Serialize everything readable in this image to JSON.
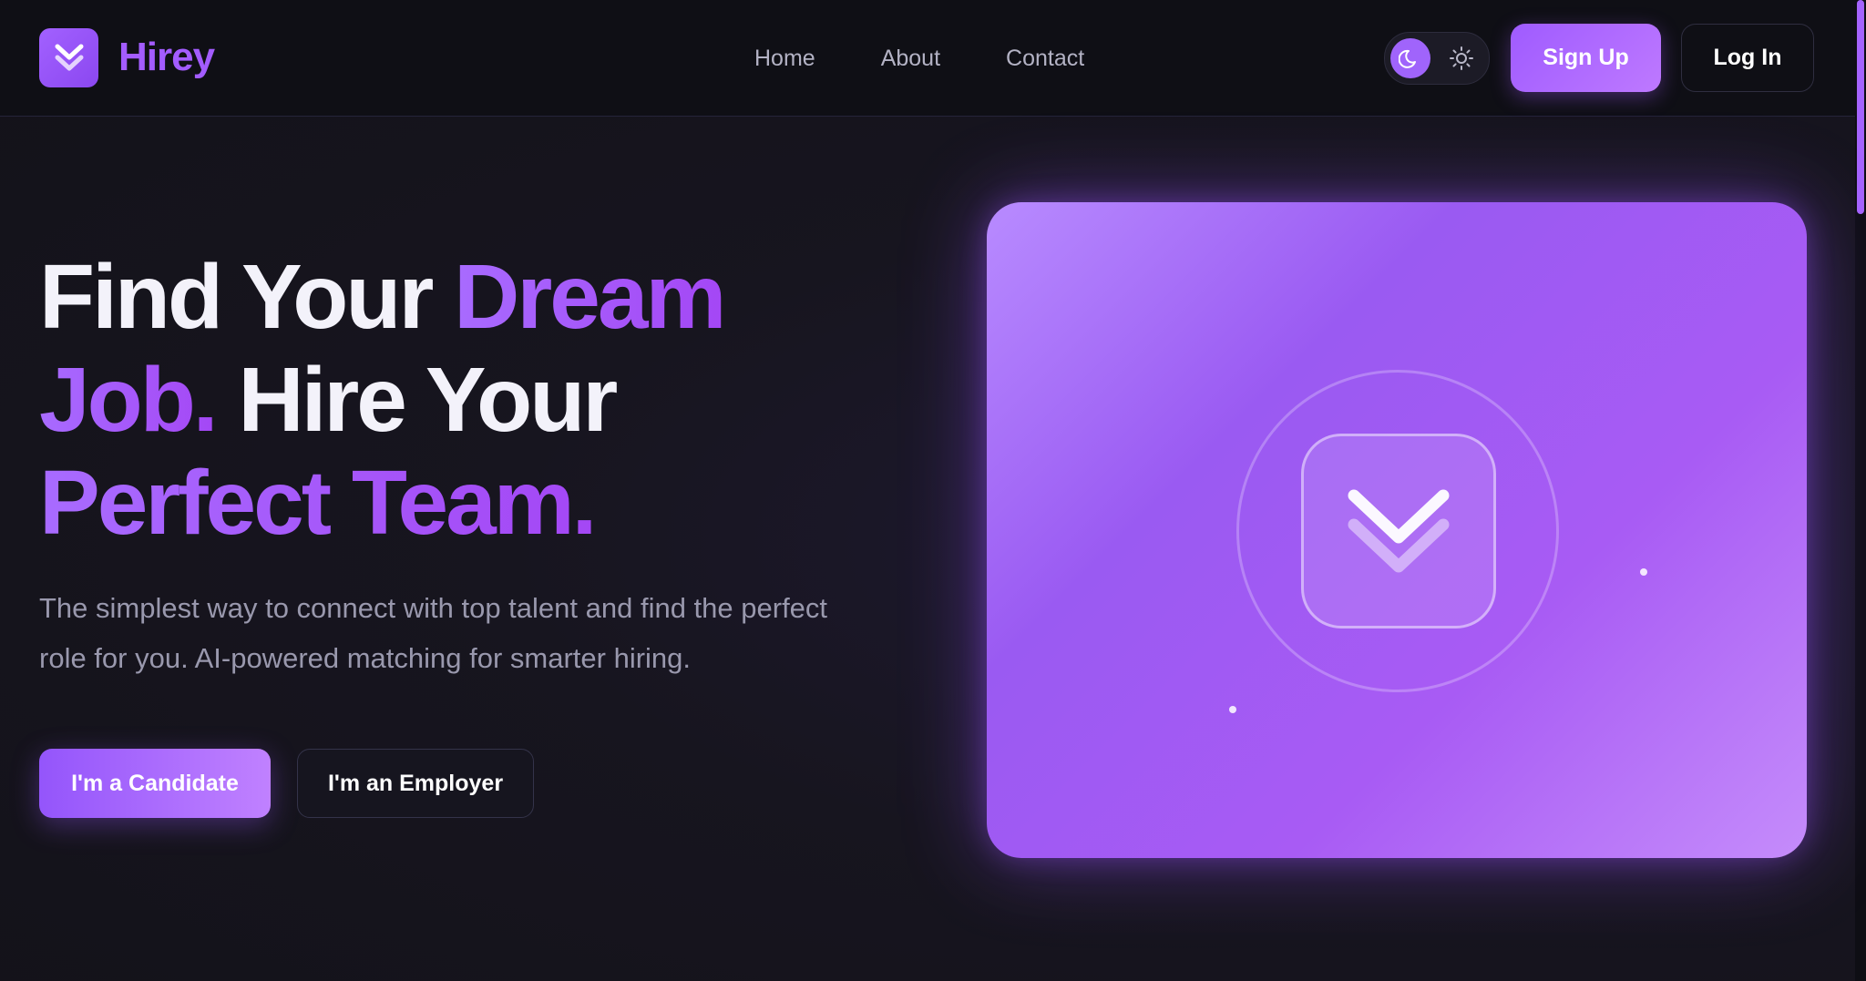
{
  "brand": {
    "name": "Hirey",
    "logo_icon": "double-chevron-down-icon",
    "accent_color": "#a35cff"
  },
  "nav": {
    "links": [
      "Home",
      "About",
      "Contact"
    ]
  },
  "theme_toggle": {
    "active": "dark",
    "dark_icon": "moon-icon",
    "light_icon": "sun-icon"
  },
  "auth": {
    "signup_label": "Sign Up",
    "login_label": "Log In"
  },
  "hero": {
    "title_line1_white": "Find Your ",
    "title_line1_accent": "Dream",
    "title_line2_accent": "Job.",
    "title_line2_white": " Hire Your",
    "title_line3_accent": "Perfect Team.",
    "subtitle": "The simplest way to connect with top talent and find the perfect role for you. AI-powered matching for smarter hiring.",
    "cta_candidate": "I'm a Candidate",
    "cta_employer": "I'm an Employer"
  },
  "illustration": {
    "icon": "double-chevron-down-icon"
  }
}
